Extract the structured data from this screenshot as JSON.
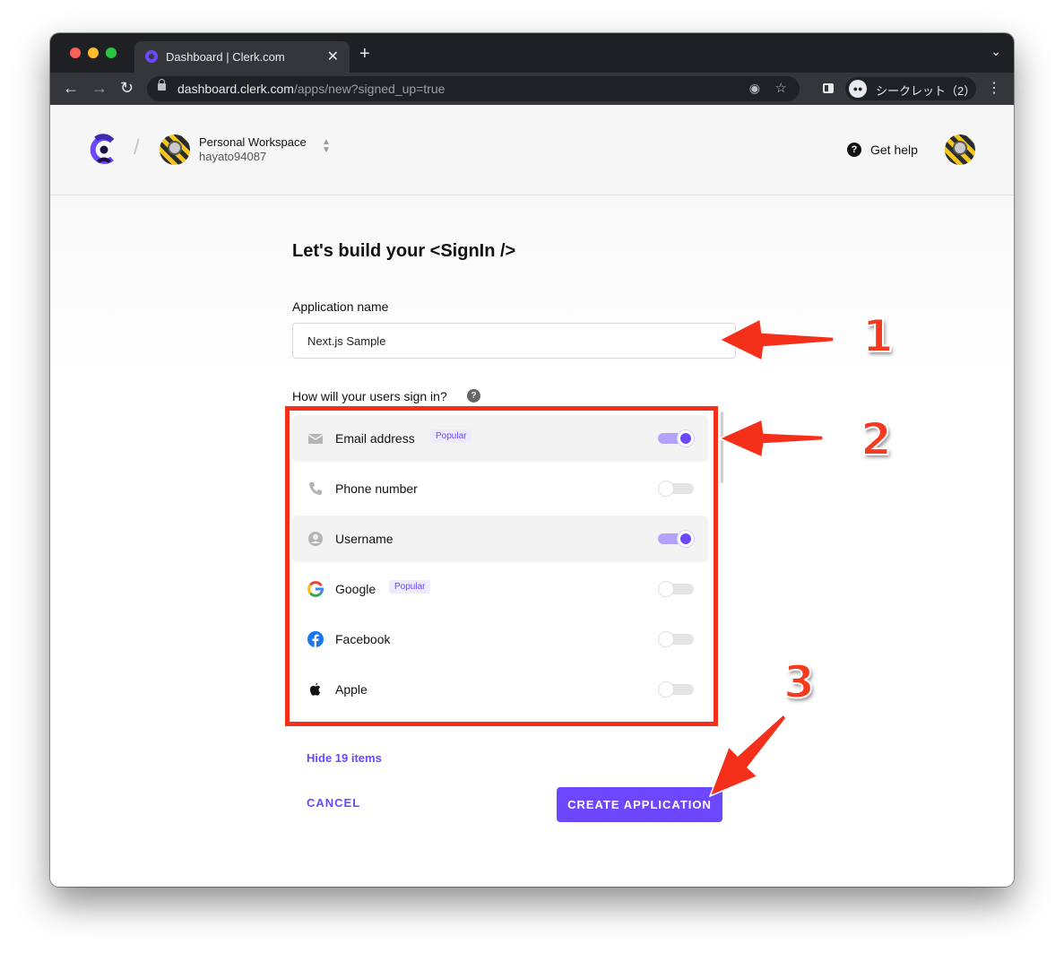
{
  "browser": {
    "tab_title": "Dashboard | Clerk.com",
    "url_host": "dashboard.clerk.com",
    "url_path": "/apps/new?signed_up=true",
    "incognito_label": "シークレット（2）"
  },
  "header": {
    "workspace_name": "Personal Workspace",
    "workspace_user": "hayato94087",
    "help_label": "Get help"
  },
  "form": {
    "title": "Let's build your <SignIn />",
    "app_name_label": "Application name",
    "app_name_value": "Next.js Sample",
    "signin_label": "How will your users sign in?",
    "options": [
      {
        "label": "Email address",
        "badge": "Popular",
        "enabled": true,
        "icon": "mail-icon"
      },
      {
        "label": "Phone number",
        "badge": "",
        "enabled": false,
        "icon": "phone-icon"
      },
      {
        "label": "Username",
        "badge": "",
        "enabled": true,
        "icon": "user-circle-icon"
      },
      {
        "label": "Google",
        "badge": "Popular",
        "enabled": false,
        "icon": "google-icon"
      },
      {
        "label": "Facebook",
        "badge": "",
        "enabled": false,
        "icon": "facebook-icon"
      },
      {
        "label": "Apple",
        "badge": "",
        "enabled": false,
        "icon": "apple-icon"
      }
    ],
    "hide_link": "Hide 19 items",
    "cancel_label": "CANCEL",
    "create_label": "CREATE APPLICATION"
  },
  "annotations": {
    "step1": "1",
    "step2": "2",
    "step3": "3",
    "color": "#f53a1f"
  },
  "colors": {
    "accent": "#6c47ff"
  }
}
